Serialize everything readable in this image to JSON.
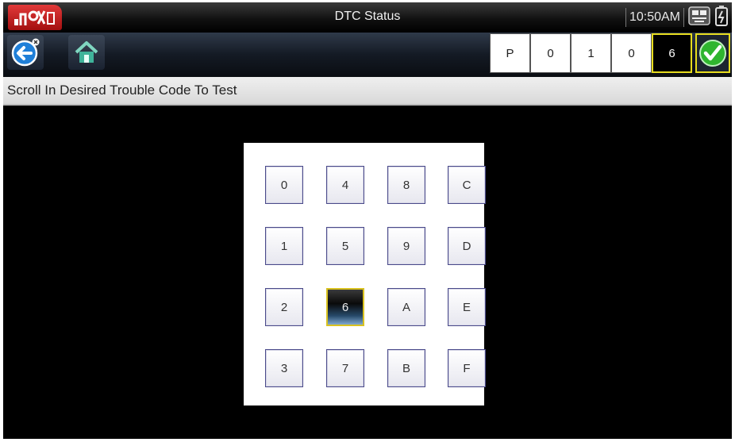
{
  "title": "DTC Status",
  "status": {
    "time": "10:50AM",
    "connection_icon": "vehicle-connection-icon",
    "battery_icon": "battery-icon"
  },
  "toolbar": {
    "back_icon": "back-arrow-icon",
    "home_icon": "home-icon",
    "code_digits": [
      "P",
      "0",
      "1",
      "0",
      "6"
    ],
    "active_digit_index": 4,
    "accept_icon": "checkmark-icon"
  },
  "instruction": "Scroll In Desired Trouble Code To Test",
  "keypad": {
    "columns": [
      [
        "0",
        "1",
        "2",
        "3"
      ],
      [
        "4",
        "5",
        "6",
        "7"
      ],
      [
        "8",
        "9",
        "A",
        "B"
      ],
      [
        "C",
        "D",
        "E",
        "F"
      ]
    ],
    "selected": "6"
  },
  "colors": {
    "highlight_border": "#e6dc1e",
    "logo_red": "#c81e1e",
    "accept_green": "#2fb52f"
  }
}
